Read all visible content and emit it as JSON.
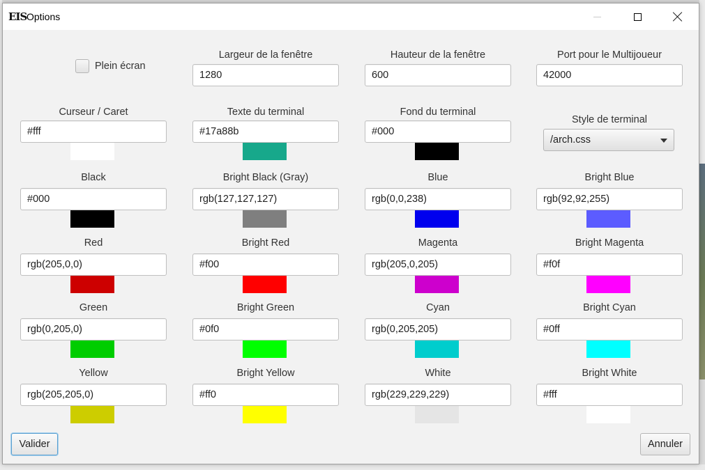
{
  "window": {
    "logo_text": "EIS",
    "title": "Options"
  },
  "fullscreen": {
    "label": "Plein écran",
    "checked": false
  },
  "top_fields": [
    {
      "label": "Largeur de la fenêtre",
      "value": "1280"
    },
    {
      "label": "Hauteur de la fenêtre",
      "value": "600"
    },
    {
      "label": "Port pour le Multijoueur",
      "value": "42000"
    }
  ],
  "terminal_fields": [
    {
      "label": "Curseur / Caret",
      "value": "#fff",
      "swatch": "#ffffff"
    },
    {
      "label": "Texte du terminal",
      "value": "#17a88b",
      "swatch": "#17a88b"
    },
    {
      "label": "Fond du terminal",
      "value": "#000",
      "swatch": "#000000"
    }
  ],
  "style": {
    "label": "Style de terminal",
    "selected": "/arch.css"
  },
  "color_rows": [
    [
      {
        "label": "Black",
        "value": "#000",
        "swatch": "#000000"
      },
      {
        "label": "Bright Black (Gray)",
        "value": "rgb(127,127,127)",
        "swatch": "#7f7f7f"
      },
      {
        "label": "Blue",
        "value": "rgb(0,0,238)",
        "swatch": "#0000ee"
      },
      {
        "label": "Bright Blue",
        "value": "rgb(92,92,255)",
        "swatch": "#5c5cff"
      }
    ],
    [
      {
        "label": "Red",
        "value": "rgb(205,0,0)",
        "swatch": "#cd0000"
      },
      {
        "label": "Bright Red",
        "value": "#f00",
        "swatch": "#ff0000"
      },
      {
        "label": "Magenta",
        "value": "rgb(205,0,205)",
        "swatch": "#cd00cd"
      },
      {
        "label": "Bright Magenta",
        "value": "#f0f",
        "swatch": "#ff00ff"
      }
    ],
    [
      {
        "label": "Green",
        "value": "rgb(0,205,0)",
        "swatch": "#00cd00"
      },
      {
        "label": "Bright Green",
        "value": "#0f0",
        "swatch": "#00ff00"
      },
      {
        "label": "Cyan",
        "value": "rgb(0,205,205)",
        "swatch": "#00cdcd"
      },
      {
        "label": "Bright Cyan",
        "value": "#0ff",
        "swatch": "#00ffff"
      }
    ],
    [
      {
        "label": "Yellow",
        "value": "rgb(205,205,0)",
        "swatch": "#cdcd00"
      },
      {
        "label": "Bright Yellow",
        "value": "#ff0",
        "swatch": "#ffff00"
      },
      {
        "label": "White",
        "value": "rgb(229,229,229)",
        "swatch": "#e5e5e5"
      },
      {
        "label": "Bright White",
        "value": "#fff",
        "swatch": "#ffffff"
      }
    ]
  ],
  "buttons": {
    "ok": "Valider",
    "cancel": "Annuler"
  },
  "icons": {
    "minimize": "minimize-icon",
    "maximize": "maximize-icon",
    "close": "close-icon",
    "dropdown": "chevron-down-icon"
  }
}
